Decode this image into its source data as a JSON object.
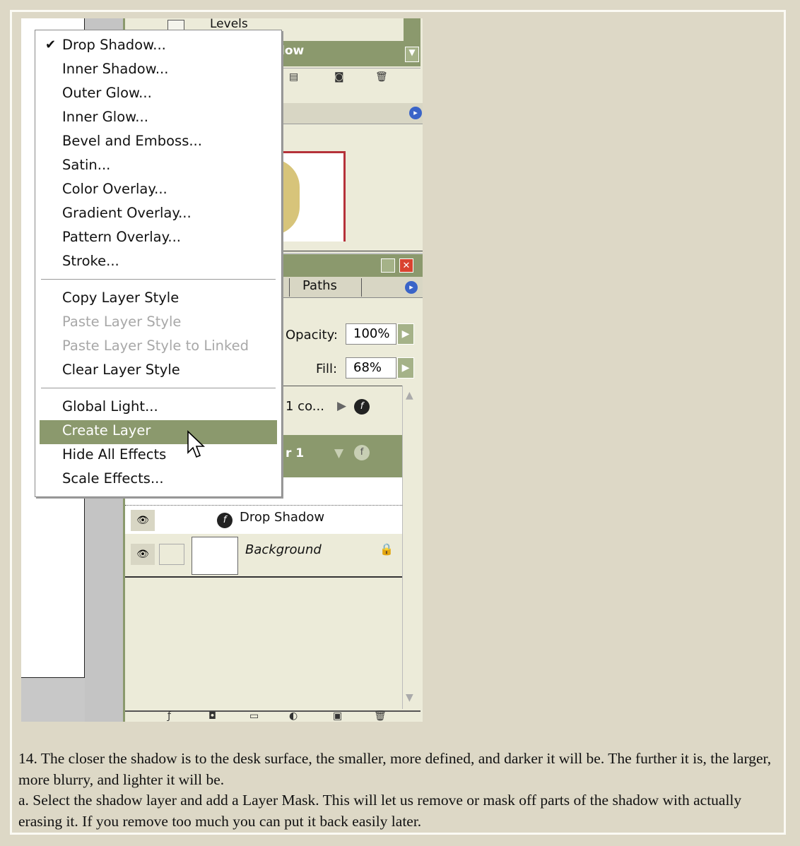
{
  "top_panel": {
    "levels_label": "Levels",
    "header_fragment": "low"
  },
  "layers_panel": {
    "tab_paths": "Paths",
    "opacity_label": "Opacity:",
    "opacity_value": "100%",
    "fill_label": "Fill:",
    "fill_value": "68%",
    "layer_partial_1": "1 co...",
    "layer_partial_2": "r 1",
    "effect_drop_shadow": "Drop Shadow",
    "background_layer": "Background"
  },
  "menu": {
    "items": [
      {
        "label": "Drop Shadow...",
        "checked": true
      },
      {
        "label": "Inner Shadow..."
      },
      {
        "label": "Outer Glow..."
      },
      {
        "label": "Inner Glow..."
      },
      {
        "label": "Bevel and Emboss..."
      },
      {
        "label": "Satin..."
      },
      {
        "label": "Color Overlay..."
      },
      {
        "label": "Gradient Overlay..."
      },
      {
        "label": "Pattern Overlay..."
      },
      {
        "label": "Stroke..."
      },
      {
        "label": "Copy Layer Style"
      },
      {
        "label": "Paste Layer Style",
        "disabled": true
      },
      {
        "label": "Paste Layer Style to Linked",
        "disabled": true
      },
      {
        "label": "Clear Layer Style"
      },
      {
        "label": "Global Light..."
      },
      {
        "label": "Create Layer",
        "highlighted": true
      },
      {
        "label": "Hide All Effects"
      },
      {
        "label": "Scale Effects..."
      }
    ]
  },
  "caption": {
    "line1": "14. The closer the shadow is to the desk surface, the smaller, more defined, and darker it will be. The further it is, the larger, more blurry, and lighter it will be.",
    "line2": "a. Select the shadow layer and add a Layer Mask. This will let us remove or mask off parts of the shadow with actually erasing it. If you remove too much you can put it back easily later."
  },
  "colors": {
    "panel_green": "#8b996d",
    "panel_bg": "#ecebd9",
    "page_bg": "#ddd8c6",
    "red_accent": "#c0392b"
  }
}
